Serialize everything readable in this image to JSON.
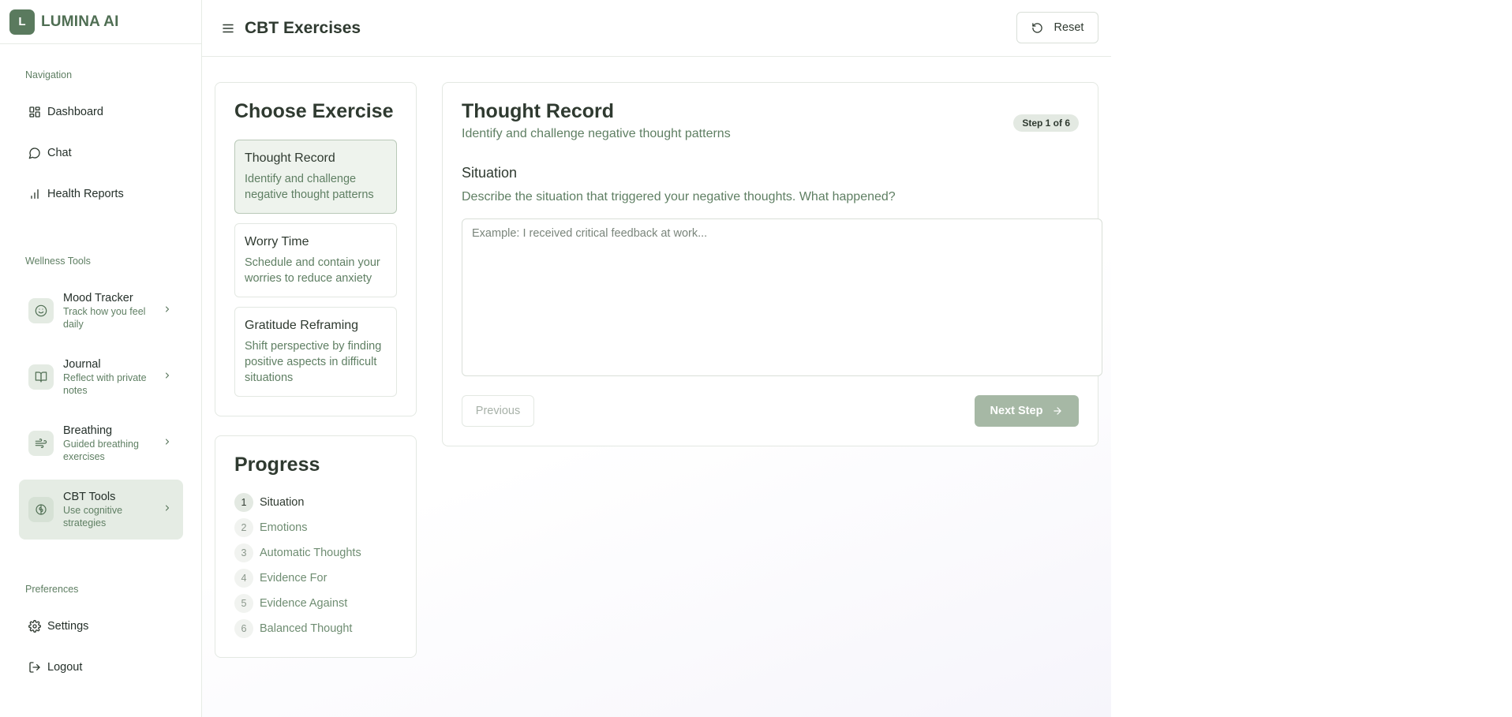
{
  "brand": {
    "logo_letter": "L",
    "name": "LUMINA AI"
  },
  "sidebar": {
    "navigation_label": "Navigation",
    "nav": [
      {
        "label": "Dashboard",
        "icon": "grid-icon"
      },
      {
        "label": "Chat",
        "icon": "message-circle-icon"
      },
      {
        "label": "Health Reports",
        "icon": "bar-chart-icon"
      }
    ],
    "wellness_label": "Wellness Tools",
    "tools": [
      {
        "title": "Mood Tracker",
        "subtitle": "Track how you feel daily",
        "icon": "smile-icon",
        "active": false
      },
      {
        "title": "Journal",
        "subtitle": "Reflect with private notes",
        "icon": "book-open-icon",
        "active": false
      },
      {
        "title": "Breathing",
        "subtitle": "Guided breathing exercises",
        "icon": "wind-icon",
        "active": false
      },
      {
        "title": "CBT Tools",
        "subtitle": "Use cognitive strategies",
        "icon": "brain-icon",
        "active": true
      }
    ],
    "preferences_label": "Preferences",
    "settings_label": "Settings",
    "logout_label": "Logout"
  },
  "header": {
    "title": "CBT Exercises",
    "reset_label": "Reset"
  },
  "choose": {
    "heading": "Choose Exercise",
    "exercises": [
      {
        "title": "Thought Record",
        "description": "Identify and challenge negative thought patterns",
        "active": true
      },
      {
        "title": "Worry Time",
        "description": "Schedule and contain your worries to reduce anxiety",
        "active": false
      },
      {
        "title": "Gratitude Reframing",
        "description": "Shift perspective by finding positive aspects in difficult situations",
        "active": false
      }
    ]
  },
  "progress": {
    "heading": "Progress",
    "steps": [
      {
        "num": "1",
        "label": "Situation"
      },
      {
        "num": "2",
        "label": "Emotions"
      },
      {
        "num": "3",
        "label": "Automatic Thoughts"
      },
      {
        "num": "4",
        "label": "Evidence For"
      },
      {
        "num": "5",
        "label": "Evidence Against"
      },
      {
        "num": "6",
        "label": "Balanced Thought"
      }
    ]
  },
  "exercise": {
    "title": "Thought Record",
    "subtitle": "Identify and challenge negative thought patterns",
    "step_badge": "Step 1 of 6",
    "section_title": "Situation",
    "prompt": "Describe the situation that triggered your negative thoughts. What happened?",
    "input_value": "",
    "placeholder": "Example: I received critical feedback at work...",
    "previous_label": "Previous",
    "next_label": "Next Step"
  },
  "colors": {
    "accent": "#5a7a5e",
    "muted_green": "#5f7f63",
    "disabled_button": "#a6b8a5"
  }
}
